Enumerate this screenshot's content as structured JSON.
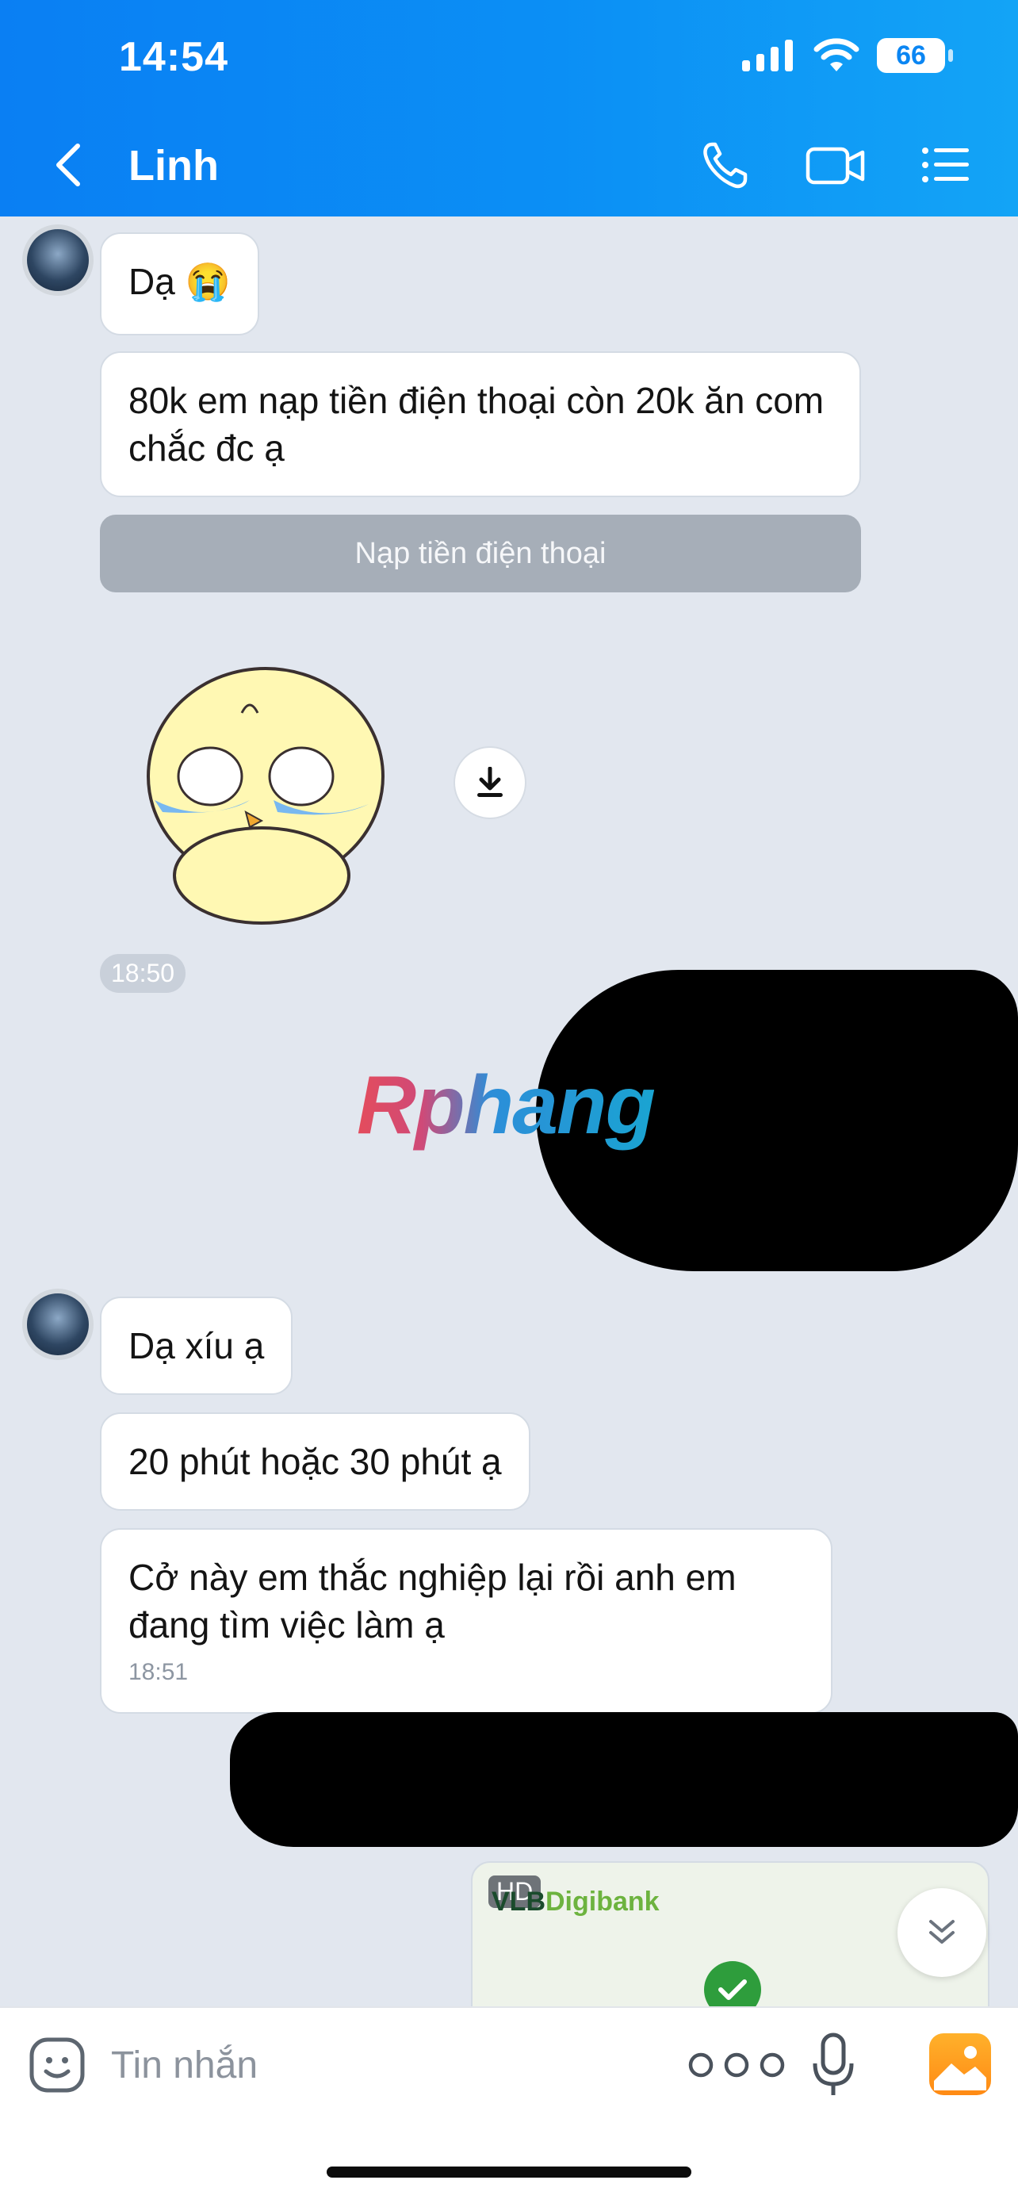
{
  "status_bar": {
    "time": "14:54",
    "battery": "66"
  },
  "header": {
    "contact_name": "Linh",
    "icons": [
      "back-icon",
      "phone-icon",
      "video-call-icon",
      "menu-list-icon"
    ]
  },
  "messages": {
    "m1": "Dạ 😭",
    "m2": "80k em nạp tiền điện thoại còn 20k ăn com chắc đc ạ",
    "action_button": "Nạp tiền điện thoại",
    "time_1": "18:50",
    "m3": "Dạ xíu ạ",
    "m4": "20 phút hoặc 30 phút ạ",
    "m5": "Cở này em thắc nghiệp lại rồi anh em đang tìm việc làm ạ",
    "m5_time": "18:51"
  },
  "watermark": "Rphang",
  "transfer_card": {
    "badge": "HD",
    "bank_prefix": "VLB",
    "bank_suffix": "Digibank"
  },
  "input": {
    "placeholder": "Tin nhắn"
  },
  "colors": {
    "header": "#0b8ff5",
    "background": "#e2e7ef",
    "bubble": "#ffffff",
    "gallery": "#ff9a1f"
  }
}
